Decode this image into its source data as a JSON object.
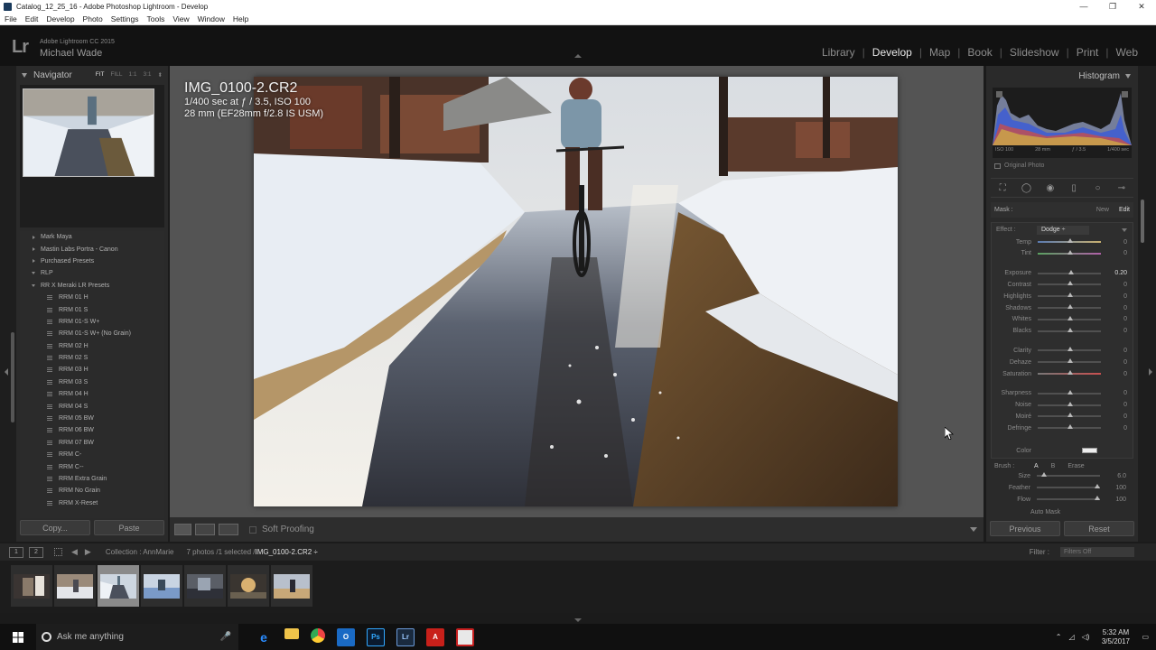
{
  "window": {
    "title": "Catalog_12_25_16 - Adobe Photoshop Lightroom - Develop",
    "controls": [
      "—",
      "❐",
      "✕"
    ]
  },
  "menu": [
    "File",
    "Edit",
    "Develop",
    "Photo",
    "Settings",
    "Tools",
    "View",
    "Window",
    "Help"
  ],
  "identity": {
    "logo": "Lr",
    "version": "Adobe Lightroom CC 2015",
    "user": "Michael Wade"
  },
  "modules": [
    "Library",
    "Develop",
    "Map",
    "Book",
    "Slideshow",
    "Print",
    "Web"
  ],
  "active_module": "Develop",
  "navigator": {
    "title": "Navigator",
    "options": [
      "FIT",
      "FILL",
      "1:1",
      "3:1"
    ],
    "selected_option": "FIT"
  },
  "presets": [
    {
      "label": "Mark Maya",
      "kind": "folder"
    },
    {
      "label": "Mastin Labs Portra - Canon",
      "kind": "folder"
    },
    {
      "label": "Purchased Presets",
      "kind": "folder"
    },
    {
      "label": "RLP",
      "kind": "open-folder"
    },
    {
      "label": "RR X Meraki LR Presets",
      "kind": "open-folder"
    },
    {
      "label": "RRM 01 H",
      "kind": "preset"
    },
    {
      "label": "RRM 01 S",
      "kind": "preset"
    },
    {
      "label": "RRM 01-S W+",
      "kind": "preset"
    },
    {
      "label": "RRM 01-S W+ (No Grain)",
      "kind": "preset"
    },
    {
      "label": "RRM 02 H",
      "kind": "preset"
    },
    {
      "label": "RRM 02 S",
      "kind": "preset"
    },
    {
      "label": "RRM 03 H",
      "kind": "preset"
    },
    {
      "label": "RRM 03 S",
      "kind": "preset"
    },
    {
      "label": "RRM 04 H",
      "kind": "preset"
    },
    {
      "label": "RRM 04 S",
      "kind": "preset"
    },
    {
      "label": "RRM 05 BW",
      "kind": "preset"
    },
    {
      "label": "RRM 06 BW",
      "kind": "preset"
    },
    {
      "label": "RRM 07 BW",
      "kind": "preset"
    },
    {
      "label": "RRM C-",
      "kind": "preset"
    },
    {
      "label": "RRM C--",
      "kind": "preset"
    },
    {
      "label": "RRM Extra Grain",
      "kind": "preset"
    },
    {
      "label": "RRM No Grain",
      "kind": "preset"
    },
    {
      "label": "RRM X-Reset",
      "kind": "preset"
    }
  ],
  "left_buttons": {
    "copy": "Copy...",
    "paste": "Paste"
  },
  "photo_info": {
    "filename": "IMG_0100-2.CR2",
    "exposure": "1/400 sec at ƒ / 3.5, ISO 100",
    "lens": "28 mm (EF28mm f/2.8 IS USM)"
  },
  "toolbar": {
    "soft_proofing": "Soft Proofing"
  },
  "histogram": {
    "title": "Histogram",
    "iso": "ISO 100",
    "focal": "28 mm",
    "aperture": "ƒ / 3.5",
    "shutter": "1/400 sec",
    "original_photo": "Original Photo"
  },
  "mask": {
    "label": "Mask :",
    "new": "New",
    "edit": "Edit"
  },
  "effect": {
    "label": "Effect :",
    "value": "Dodge ÷"
  },
  "sliders": [
    {
      "name": "Temp",
      "value": "0",
      "group": 0
    },
    {
      "name": "Tint",
      "value": "0",
      "group": 0
    },
    {
      "name": "Exposure",
      "value": "0.20",
      "group": 1
    },
    {
      "name": "Contrast",
      "value": "0",
      "group": 1
    },
    {
      "name": "Highlights",
      "value": "0",
      "group": 1
    },
    {
      "name": "Shadows",
      "value": "0",
      "group": 1
    },
    {
      "name": "Whites",
      "value": "0",
      "group": 1
    },
    {
      "name": "Blacks",
      "value": "0",
      "group": 1
    },
    {
      "name": "Clarity",
      "value": "0",
      "group": 2
    },
    {
      "name": "Dehaze",
      "value": "0",
      "group": 2
    },
    {
      "name": "Saturation",
      "value": "0",
      "group": 2
    },
    {
      "name": "Sharpness",
      "value": "0",
      "group": 3
    },
    {
      "name": "Noise",
      "value": "0",
      "group": 3
    },
    {
      "name": "Moiré",
      "value": "0",
      "group": 3
    },
    {
      "name": "Defringe",
      "value": "0",
      "group": 3
    }
  ],
  "color_label": "Color",
  "brush": {
    "label": "Brush :",
    "a": "A",
    "b": "B",
    "erase": "Erase",
    "size_label": "Size",
    "size": "6.0",
    "feather_label": "Feather",
    "feather": "100",
    "flow_label": "Flow",
    "flow": "100",
    "auto_mask": "Auto Mask"
  },
  "right_buttons": {
    "previous": "Previous",
    "reset": "Reset"
  },
  "filmstrip": {
    "screen1": "1",
    "screen2": "2",
    "collection": "Collection : AnnMarie",
    "count": "7 photos /1 selected /",
    "selected_file": "IMG_0100-2.CR2 ÷",
    "filter_label": "Filter :",
    "filter_value": "Filters Off"
  },
  "taskbar": {
    "search_placeholder": "Ask me anything",
    "time": "5:32 AM",
    "date": "3/5/2017"
  },
  "colors": {
    "lr_panel": "#2a2a2a",
    "lr_center": "#545454",
    "accent_ps": "#31a8ff",
    "accent_lr": "#31a8ff"
  }
}
